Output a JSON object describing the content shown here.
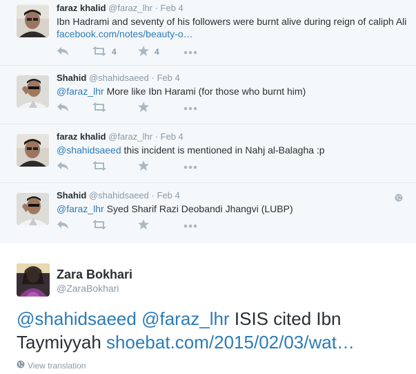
{
  "thread": [
    {
      "fullname": "faraz khalid",
      "handle": "@faraz_lhr",
      "time": "Feb 4",
      "text_before": "Ibn Hadrami and seventy of his followers were burnt alive during reign of caliph Ali ",
      "link": "facebook.com/notes/beauty-o…",
      "text_after": "",
      "retweets": "4",
      "favorites": "4"
    },
    {
      "fullname": "Shahid",
      "handle": "@shahidsaeed",
      "time": "Feb 4",
      "mention": "@faraz_lhr",
      "text": " More like Ibn Harami (for those who burnt him)"
    },
    {
      "fullname": "faraz khalid",
      "handle": "@faraz_lhr",
      "time": "Feb 4",
      "mention": "@shahidsaeed",
      "text": " this incident is mentioned in Nahj al-Balagha :p"
    },
    {
      "fullname": "Shahid",
      "handle": "@shahidsaeed",
      "time": "Feb 4",
      "mention": "@faraz_lhr",
      "text": " Syed Sharif Razi Deobandi Jhangvi (LUBP)"
    }
  ],
  "main_tweet": {
    "fullname": "Zara Bokhari",
    "handle": "@ZaraBokhari",
    "mention1": "@shahidsaeed",
    "mention2": "@faraz_lhr",
    "text": " ISIS cited Ibn Taymiyyah ",
    "link": "shoebat.com/2015/02/03/wat…",
    "translate_label": "View translation"
  },
  "icons": {
    "reply": "reply-icon",
    "retweet": "retweet-icon",
    "favorite": "star-icon",
    "more": "more-icon",
    "globe": "globe-icon"
  },
  "colors": {
    "link": "#2b7bb9",
    "muted": "#8899a6",
    "icon": "#aab8c2",
    "thread_bg": "#f5f8fa"
  }
}
